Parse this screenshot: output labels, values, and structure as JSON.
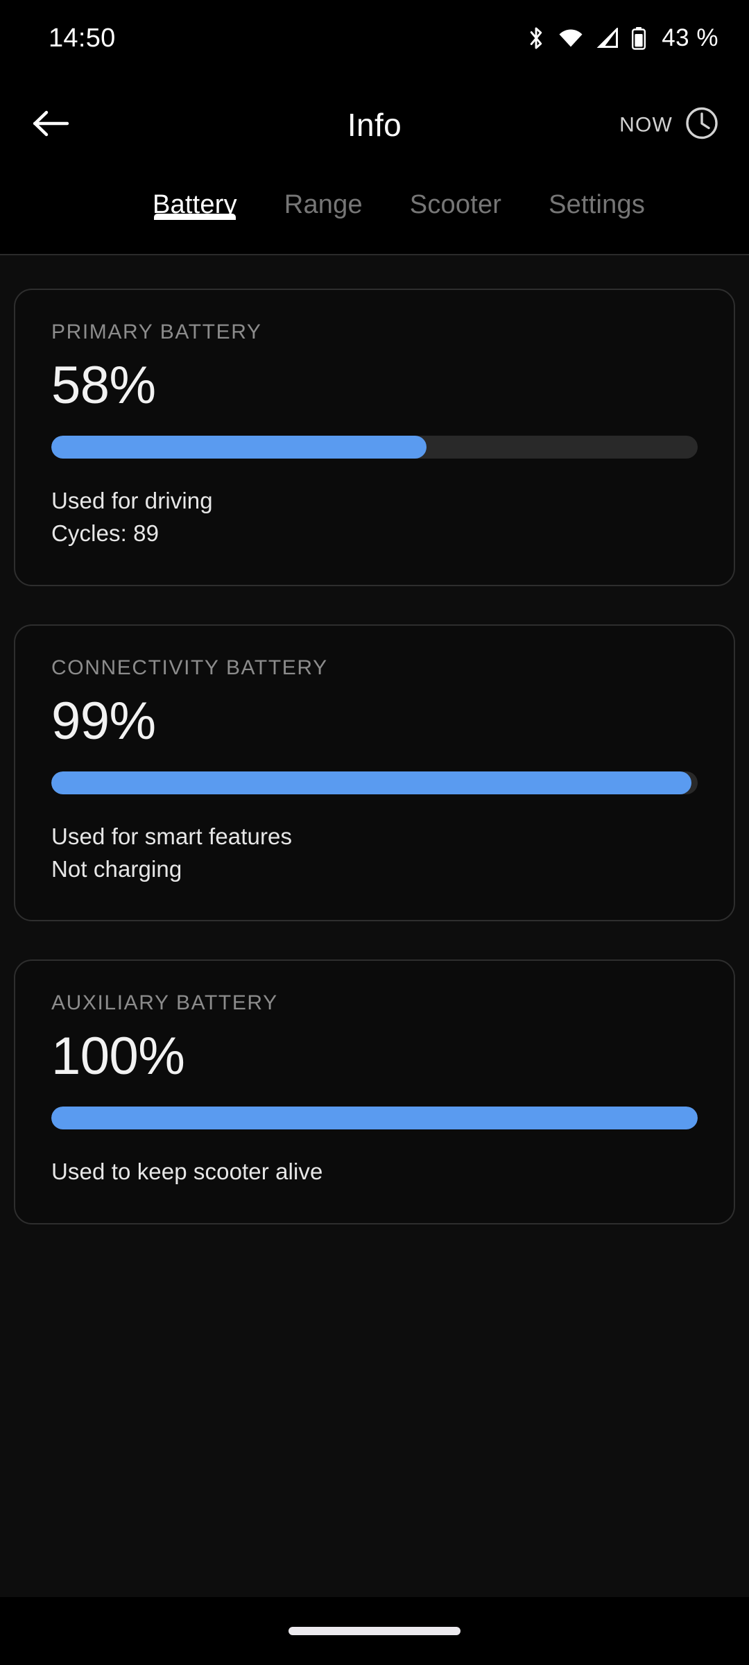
{
  "status_bar": {
    "time": "14:50",
    "battery_percent": "43 %",
    "icons": [
      "bluetooth-icon",
      "wifi-icon",
      "cellular-signal-icon",
      "battery-icon"
    ]
  },
  "app_bar": {
    "back_label": "back-arrow-icon",
    "title": "Info",
    "now_label": "NOW",
    "clock_icon": "clock-icon"
  },
  "tabs": {
    "items": [
      {
        "label": "Battery",
        "active": true
      },
      {
        "label": "Range",
        "active": false
      },
      {
        "label": "Scooter",
        "active": false
      },
      {
        "label": "Settings",
        "active": false
      }
    ]
  },
  "colors": {
    "accent": "#5a9bf0",
    "track": "#292929",
    "card_border": "#2e2e2e",
    "background": "#0d0d0d",
    "text_primary": "#f2f2f2",
    "text_secondary": "#8c8c8c"
  },
  "cards": [
    {
      "label": "PRIMARY BATTERY",
      "percent_text": "58%",
      "percent_value": 58,
      "notes": [
        "Used for driving",
        "Cycles: 89"
      ]
    },
    {
      "label": "CONNECTIVITY BATTERY",
      "percent_text": "99%",
      "percent_value": 99,
      "notes": [
        "Used for smart features",
        "Not charging"
      ]
    },
    {
      "label": "AUXILIARY BATTERY",
      "percent_text": "100%",
      "percent_value": 100,
      "notes": [
        "Used to keep scooter alive"
      ]
    }
  ]
}
